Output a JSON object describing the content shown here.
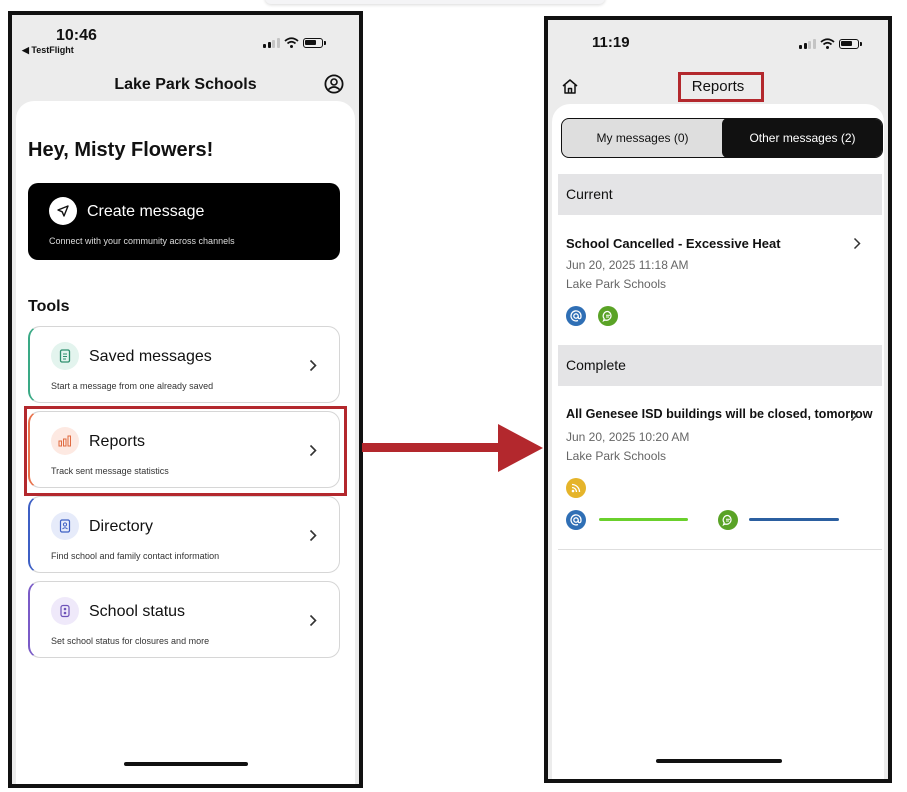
{
  "left_phone": {
    "time": "10:46",
    "back_app": "◀ TestFlight",
    "header_title": "Lake Park Schools",
    "icons": {
      "account": "account-circle-icon",
      "create": "send-icon"
    },
    "greeting": "Hey, Misty Flowers!",
    "create": {
      "label": "Create message",
      "description": "Connect with your community across channels"
    },
    "tools_heading": "Tools",
    "tools": [
      {
        "label": "Saved messages",
        "description": "Start a message from one already saved",
        "icon": "document-icon",
        "accent": "#3aa985",
        "tint": "#e3f4ee"
      },
      {
        "label": "Reports",
        "description": "Track sent message statistics",
        "icon": "bar-chart-icon",
        "accent": "#e8714a",
        "tint": "#fde9e2"
      },
      {
        "label": "Directory",
        "description": "Find school and family contact information",
        "icon": "contact-card-icon",
        "accent": "#3d5fc4",
        "tint": "#e6ebfa"
      },
      {
        "label": "School status",
        "description": "Set school status for closures and more",
        "icon": "status-icon",
        "accent": "#7a5bc7",
        "tint": "#efe9fa"
      }
    ]
  },
  "right_phone": {
    "time": "11:19",
    "header_title": "Reports",
    "icons": {
      "home": "home-icon"
    },
    "tabs": [
      {
        "label": "My messages (0)",
        "active": false
      },
      {
        "label": "Other messages (2)",
        "active": true
      }
    ],
    "sections": [
      {
        "title": "Current",
        "messages": [
          {
            "title": "School Cancelled - Excessive Heat",
            "date": "Jun 20, 2025 11:18 AM",
            "org": "Lake Park Schools",
            "channels": [
              "email",
              "sms"
            ]
          }
        ]
      },
      {
        "title": "Complete",
        "messages": [
          {
            "title": "All Genesee ISD buildings will be closed, tomorrow",
            "date": "Jun 20, 2025 10:20 AM",
            "org": "Lake Park Schools",
            "channels": [
              "rss",
              "email",
              "sms"
            ]
          }
        ]
      }
    ]
  },
  "colors": {
    "highlight": "#b3282d",
    "email_channel": "#2f6fb5",
    "sms_channel": "#5aa326",
    "rss_channel": "#e5b42a",
    "email_progress": "#6ad02c",
    "sms_progress": "#2b5fa0"
  }
}
